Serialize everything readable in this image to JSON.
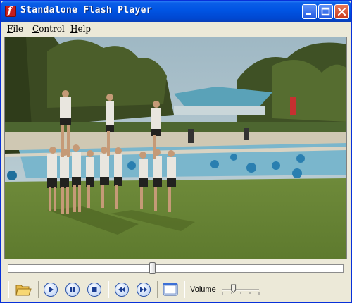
{
  "window": {
    "title": "Standalone Flash Player"
  },
  "menu": [
    {
      "first": "F",
      "rest": "ile"
    },
    {
      "first": "C",
      "rest": "ontrol"
    },
    {
      "first": "H",
      "rest": "elp"
    }
  ],
  "playback": {
    "position_fraction": 0.43
  },
  "volume": {
    "label": "Volume",
    "level_fraction": 0.3
  },
  "icons": [
    "flash-app-icon",
    "minimize-icon",
    "maximize-icon",
    "close-icon",
    "open-folder-icon",
    "play-icon",
    "pause-icon",
    "stop-icon",
    "rewind-icon",
    "fast-forward-icon",
    "fullscreen-icon",
    "volume-slider"
  ]
}
